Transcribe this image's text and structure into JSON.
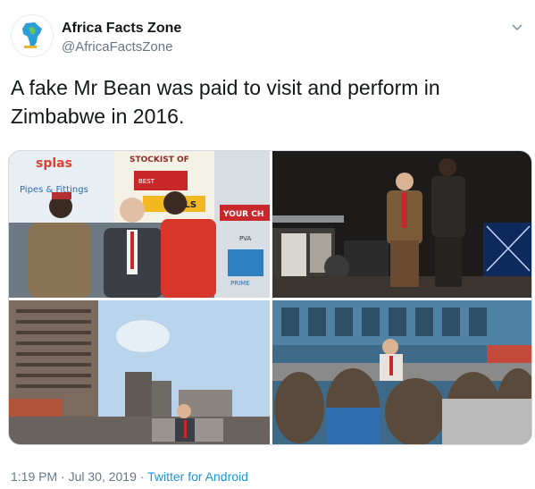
{
  "account": {
    "name": "Africa Facts Zone",
    "handle": "@AfricaFactsZone"
  },
  "tweet": {
    "text": "A fake Mr Bean was paid to visit and perform in Zimbabwe in 2016."
  },
  "meta": {
    "time": "1:19 PM",
    "separator": " · ",
    "date": "Jul 30, 2019",
    "source": "Twitter for Android"
  },
  "photos": {
    "p1": {
      "sign_splash": "splas",
      "sign_pipes": "Pipes & Fittings",
      "sign_stockist": "STOCKIST OF",
      "sign_best": "BEST",
      "sign_tools": "OLS",
      "sign_your": "YOUR CH",
      "sign_pva": "PVA",
      "sign_prime": "PRIME"
    }
  },
  "colors": {
    "name": "#14171a",
    "secondary": "#657786",
    "link": "#1b95e0"
  },
  "icons": {
    "chevron": "chevron-down-icon",
    "avatar": "africa-map-logo"
  }
}
